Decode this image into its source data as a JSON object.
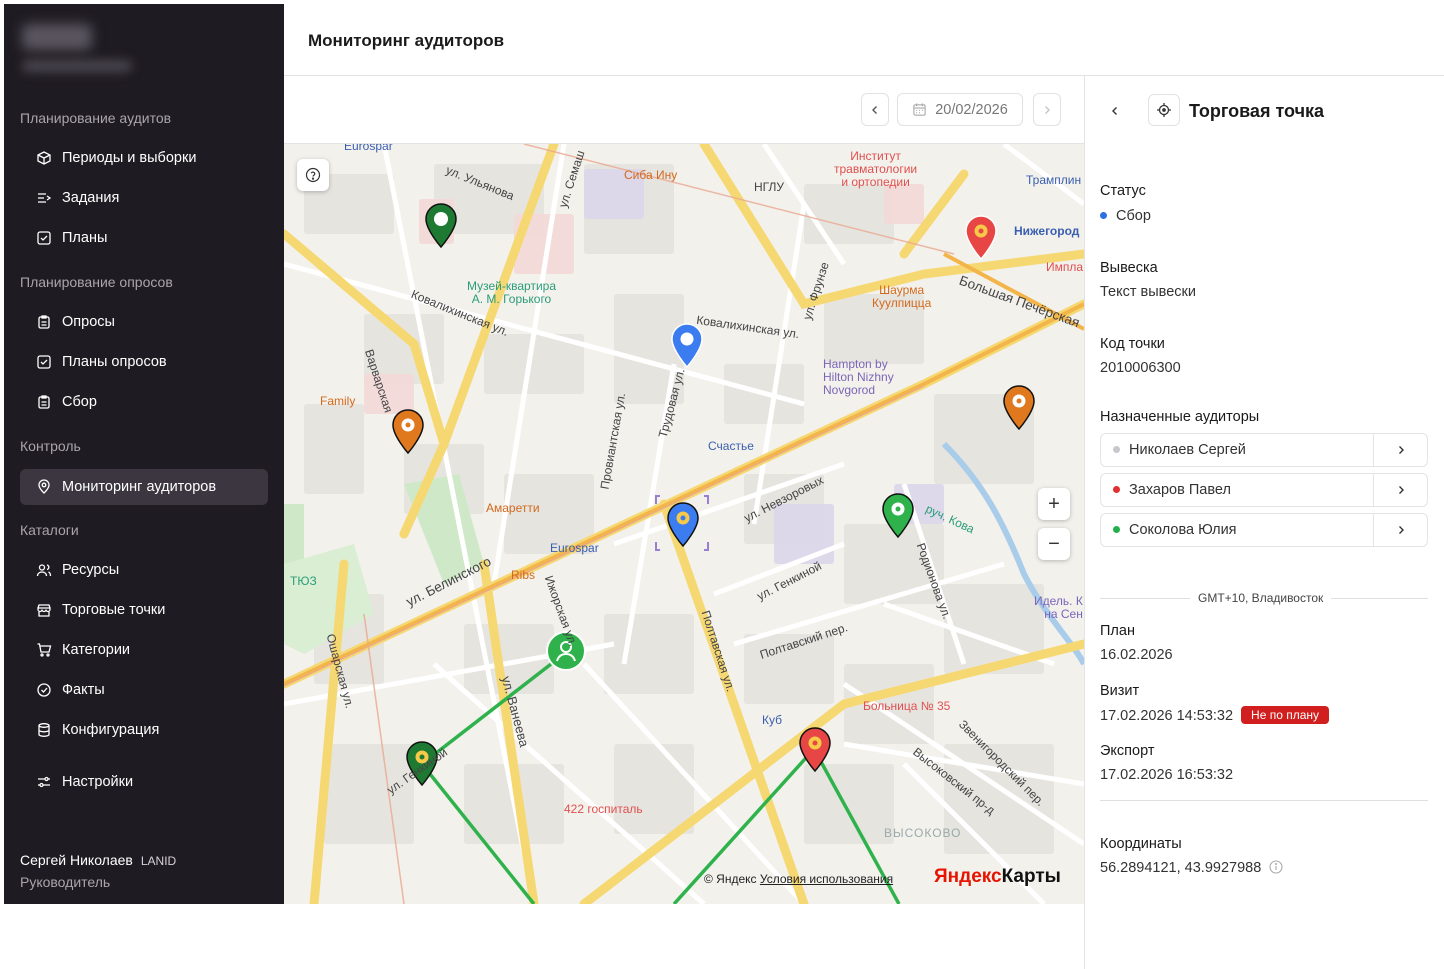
{
  "header": {
    "title": "Мониторинг аудиторов"
  },
  "sidebar": {
    "sections": [
      {
        "title": "Планирование аудитов"
      },
      {
        "title": "Планирование опросов"
      },
      {
        "title": "Контроль"
      },
      {
        "title": "Каталоги"
      }
    ],
    "items": [
      {
        "label": "Периоды и выборки",
        "icon": "box-icon"
      },
      {
        "label": "Задания",
        "icon": "list-arrow-icon"
      },
      {
        "label": "Планы",
        "icon": "checkbox-icon"
      },
      {
        "label": "Опросы",
        "icon": "clipboard-icon"
      },
      {
        "label": "Планы опросов",
        "icon": "checkbox-icon"
      },
      {
        "label": "Сбор",
        "icon": "clipboard-icon"
      },
      {
        "label": "Мониторинг аудиторов",
        "icon": "location-pin-icon",
        "active": true
      },
      {
        "label": "Ресурсы",
        "icon": "users-icon"
      },
      {
        "label": "Торговые точки",
        "icon": "store-icon"
      },
      {
        "label": "Категории",
        "icon": "cart-icon"
      },
      {
        "label": "Факты",
        "icon": "check-circle-icon"
      },
      {
        "label": "Конфигурация",
        "icon": "database-icon"
      },
      {
        "label": "Настройки",
        "icon": "sliders-icon"
      }
    ],
    "user": {
      "name": "Сергей Николаев",
      "org": "LANID",
      "role": "Руководитель"
    }
  },
  "toolbar": {
    "date": "20/02/2026"
  },
  "map": {
    "labels": {
      "eurospar_top": "Eurospar",
      "siba_inu": "Сиба Ину",
      "nglu": "НГЛУ",
      "institute": "Институт\nтравматологии\nи ортопедии",
      "trampoline": "Трамплин",
      "nizhegorod": "Нижегород",
      "impla": "Импла",
      "museum": "Музей-квартира\nА. М. Горького",
      "shaurma": "Шаурма\nКуулпицца",
      "hampton": "Hampton by\nHilton Nizhny\nNovgorod",
      "family": "Family",
      "schastye": "Счастье",
      "amaretti": "Амаретти",
      "eurospar": "Eurospar",
      "ribs": "Ribs",
      "tyuz": "ТЮЗ",
      "idel": "Идель. К\nна Сен",
      "kub": "Куб",
      "bolnitsa": "Больница № 35",
      "gospital": "422 госпиталь",
      "vysokovo": "ВЫСОКОВО",
      "ul_ulyanova": "ул. Ульянова",
      "ul_semash": "ул. Семаш",
      "kovalikhinskaya1": "Ковалихинская ул.",
      "kovalikhinskaya2": "Ковалихинская ул.",
      "bolshaya_pech": "Большая Печёрская",
      "ul_belinskogo": "ул. Белинского",
      "ul_nevzorovykh": "ул. Невзоровых",
      "ul_genkinoy": "ул. Генкиной",
      "ul_vaneeva": "ул. Ванеева",
      "poltavskaya": "Полтавская ул.",
      "ru_kova": "руч. Кова",
      "rodionova": "Родионова ул.",
      "vysokovsky": "Высоковский пр-д",
      "provianskaya": "Провиантская ул.",
      "trudovaya": "Трудовая ул.",
      "varvarskaya": "Варварская",
      "osharskaya": "Ошарская ул.",
      "izhorskaya": "Ижорская ул.",
      "ul_frunze": "ул. Фрунзе",
      "poltavsky_per": "Полтавский пер.",
      "zvenigorodsky": "Звенигородский пер.",
      "ul_gagarina": "ул. Генкиной"
    },
    "copyright": "© Яндекс",
    "terms": "Условия использования",
    "brand_ya": "Яндекс",
    "brand_maps": "Карты"
  },
  "panel": {
    "title": "Торговая точка",
    "status_label": "Статус",
    "status_value": "Сбор",
    "sign_label": "Вывеска",
    "sign_value": "Текст вывески",
    "code_label": "Код точки",
    "code_value": "2010006300",
    "auditors_label": "Назначенные аудиторы",
    "auditors": [
      {
        "name": "Николаев Сергей",
        "color": "#c8c8cc"
      },
      {
        "name": "Захаров Павел",
        "color": "#e03030"
      },
      {
        "name": "Соколова Юлия",
        "color": "#22b04b"
      }
    ],
    "timezone": "GMT+10, Владивосток",
    "plan_label": "План",
    "plan_value": "16.02.2026",
    "visit_label": "Визит",
    "visit_value": "17.02.2026 14:53:32",
    "visit_badge": "Не по плану",
    "export_label": "Экспорт",
    "export_value": "17.02.2026 16:53:32",
    "coords_label": "Координаты",
    "coords_value": "56.2894121, 43.9927988"
  },
  "colors": {
    "sidebar_bg": "#1f1b22",
    "accent_status": "#2f6fe4",
    "badge_red": "#d11f1f",
    "route_green": "#2fb24c"
  }
}
